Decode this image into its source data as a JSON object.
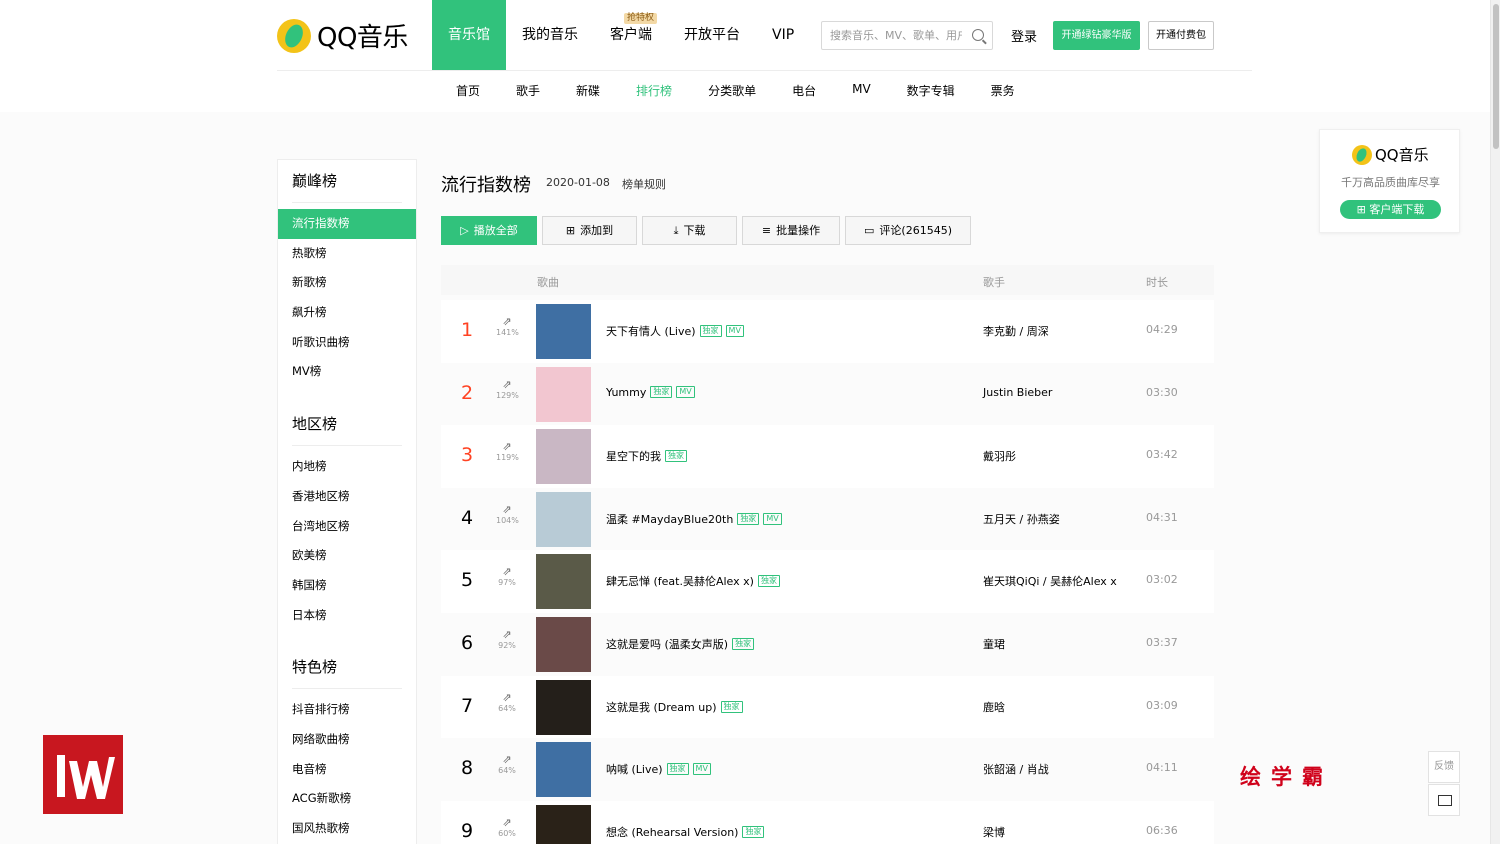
{
  "header": {
    "logo_text": "QQ音乐",
    "nav": [
      {
        "label": "音乐馆",
        "active": true
      },
      {
        "label": "我的音乐",
        "active": false
      },
      {
        "label": "客户端",
        "active": false,
        "badge": "抢特权"
      },
      {
        "label": "开放平台",
        "active": false
      },
      {
        "label": "VIP",
        "active": false
      }
    ],
    "search_placeholder": "搜索音乐、MV、歌单、用户",
    "login": "登录",
    "vip_button": "开通绿钻豪华版",
    "pay_button": "开通付费包",
    "subnav": [
      {
        "label": "首页",
        "active": false
      },
      {
        "label": "歌手",
        "active": false
      },
      {
        "label": "新碟",
        "active": false
      },
      {
        "label": "排行榜",
        "active": true
      },
      {
        "label": "分类歌单",
        "active": false
      },
      {
        "label": "电台",
        "active": false
      },
      {
        "label": "MV",
        "active": false
      },
      {
        "label": "数字专辑",
        "active": false
      },
      {
        "label": "票务",
        "active": false
      }
    ]
  },
  "sidebar": {
    "groups": [
      {
        "title": "巅峰榜",
        "items": [
          {
            "label": "流行指数榜",
            "active": true
          },
          {
            "label": "热歌榜"
          },
          {
            "label": "新歌榜"
          },
          {
            "label": "飙升榜"
          },
          {
            "label": "听歌识曲榜"
          },
          {
            "label": "MV榜"
          }
        ]
      },
      {
        "title": "地区榜",
        "items": [
          {
            "label": "内地榜"
          },
          {
            "label": "香港地区榜"
          },
          {
            "label": "台湾地区榜"
          },
          {
            "label": "欧美榜"
          },
          {
            "label": "韩国榜"
          },
          {
            "label": "日本榜"
          }
        ]
      },
      {
        "title": "特色榜",
        "items": [
          {
            "label": "抖音排行榜"
          },
          {
            "label": "网络歌曲榜"
          },
          {
            "label": "电音榜"
          },
          {
            "label": "ACG新歌榜"
          },
          {
            "label": "国风热歌榜"
          }
        ]
      }
    ]
  },
  "main": {
    "title": "流行指数榜",
    "date": "2020-01-08",
    "rule": "榜单规则",
    "toolbar": {
      "play_all": "播放全部",
      "add_to": "添加到",
      "download": "下载",
      "batch": "批量操作",
      "comment": "评论(261545)"
    },
    "columns": {
      "song": "歌曲",
      "singer": "歌手",
      "duration": "时长"
    },
    "songs": [
      {
        "rank": "1",
        "trend": "141%",
        "title": "天下有情人 (Live)",
        "tags": [
          "独家",
          "MV"
        ],
        "singer": "李克勤 / 周深",
        "duration": "04:29",
        "cover": "#3f6fa3"
      },
      {
        "rank": "2",
        "trend": "129%",
        "title": "Yummy",
        "tags": [
          "独家",
          "MV"
        ],
        "singer": "Justin Bieber",
        "duration": "03:30",
        "cover": "#f2c6d0"
      },
      {
        "rank": "3",
        "trend": "119%",
        "title": "星空下的我",
        "tags": [
          "独家"
        ],
        "singer": "戴羽彤",
        "duration": "03:42",
        "cover": "#c9b7c4"
      },
      {
        "rank": "4",
        "trend": "104%",
        "title": "温柔 #MaydayBlue20th",
        "tags": [
          "独家",
          "MV"
        ],
        "singer": "五月天 / 孙燕姿",
        "duration": "04:31",
        "cover": "#b8cbd6"
      },
      {
        "rank": "5",
        "trend": "97%",
        "title": "肆无忌惮 (feat.吴赫伦Alex x)",
        "tags": [
          "独家"
        ],
        "singer": "崔天琪QiQi / 吴赫伦Alex x",
        "duration": "03:02",
        "cover": "#5a5a48"
      },
      {
        "rank": "6",
        "trend": "92%",
        "title": "这就是爱吗 (温柔女声版)",
        "tags": [
          "独家"
        ],
        "singer": "童珺",
        "duration": "03:37",
        "cover": "#6a4a48"
      },
      {
        "rank": "7",
        "trend": "64%",
        "title": "这就是我 (Dream up)",
        "tags": [
          "独家"
        ],
        "singer": "鹿晗",
        "duration": "03:09",
        "cover": "#241f1a"
      },
      {
        "rank": "8",
        "trend": "64%",
        "title": "呐喊 (Live)",
        "tags": [
          "独家",
          "MV"
        ],
        "singer": "张韶涵 / 肖战",
        "duration": "04:11",
        "cover": "#3f6fa3"
      },
      {
        "rank": "9",
        "trend": "60%",
        "title": "想念 (Rehearsal Version)",
        "tags": [
          "独家"
        ],
        "singer": "梁博",
        "duration": "06:36",
        "cover": "#2a2218"
      }
    ]
  },
  "ad": {
    "logo_text": "QQ音乐",
    "subtitle": "千万高品质曲库尽享",
    "button": "客户端下载"
  },
  "float": {
    "feedback": "反馈"
  },
  "watermark": {
    "text": "绘学霸"
  },
  "colors": {
    "accent": "#31c27c",
    "top_rank": "#ff4222"
  }
}
